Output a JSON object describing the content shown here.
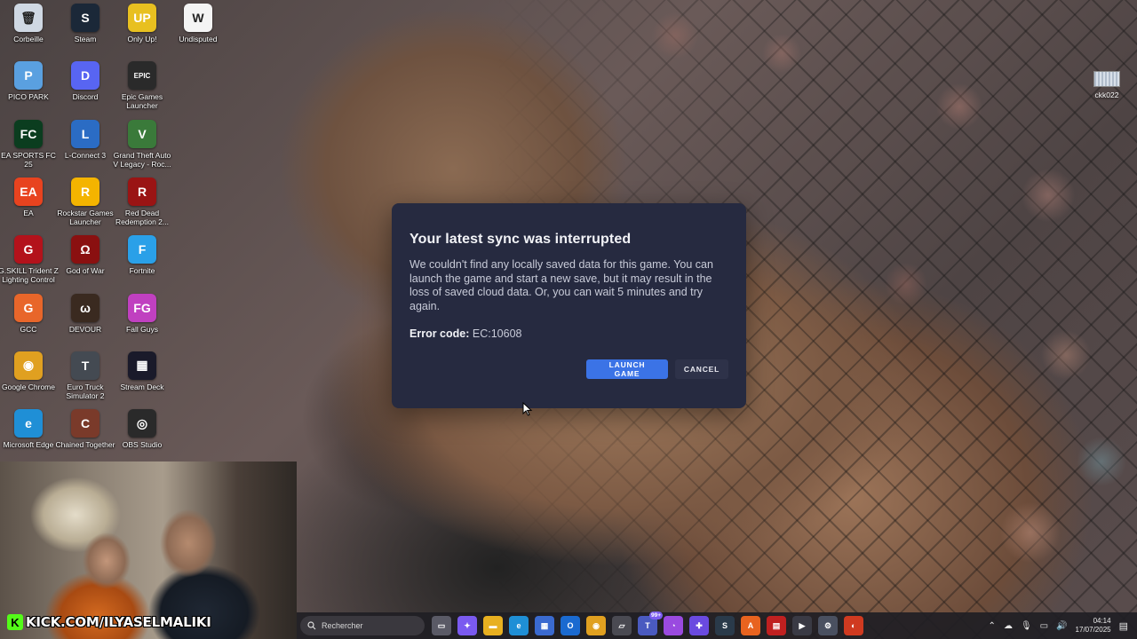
{
  "desktop": {
    "columns": [
      [
        {
          "label": "Corbeille",
          "icon": "recycle-bin-icon",
          "color": "#cfd8e3",
          "glyph": "🗑"
        },
        {
          "label": "PICO PARK",
          "icon": "pico-park-icon",
          "color": "#5aa0e0",
          "glyph": "P"
        },
        {
          "label": "EA SPORTS FC 25",
          "icon": "ea-fc-icon",
          "color": "#0b3d1f",
          "glyph": "FC"
        },
        {
          "label": "EA",
          "icon": "ea-icon",
          "color": "#e8431f",
          "glyph": "EA"
        },
        {
          "label": "G.SKILL Trident Z Lighting Control",
          "icon": "gskill-icon",
          "color": "#b3121b",
          "glyph": "G"
        },
        {
          "label": "GCC",
          "icon": "gcc-icon",
          "color": "#e8662a",
          "glyph": "G"
        },
        {
          "label": "Google Chrome",
          "icon": "chrome-icon",
          "color": "#e0a020",
          "glyph": "◉"
        },
        {
          "label": "Microsoft Edge",
          "icon": "edge-icon",
          "color": "#1f8fd6",
          "glyph": "e"
        }
      ],
      [
        {
          "label": "Steam",
          "icon": "steam-icon",
          "color": "#1b2838",
          "glyph": "S"
        },
        {
          "label": "Discord",
          "icon": "discord-icon",
          "color": "#5865f2",
          "glyph": "D"
        },
        {
          "label": "L-Connect 3",
          "icon": "l-connect-icon",
          "color": "#2b6cc4",
          "glyph": "L"
        },
        {
          "label": "Rockstar Games Launcher",
          "icon": "rockstar-icon",
          "color": "#f4b400",
          "glyph": "R"
        },
        {
          "label": "God of War",
          "icon": "god-of-war-icon",
          "color": "#8a1010",
          "glyph": "Ω"
        },
        {
          "label": "DEVOUR",
          "icon": "devour-icon",
          "color": "#3a2a20",
          "glyph": "ω"
        },
        {
          "label": "Euro Truck Simulator 2",
          "icon": "ets2-icon",
          "color": "#444a52",
          "glyph": "T"
        },
        {
          "label": "Chained Together",
          "icon": "chained-together-icon",
          "color": "#7a3a2a",
          "glyph": "C"
        }
      ],
      [
        {
          "label": "Only Up!",
          "icon": "only-up-icon",
          "color": "#e8c020",
          "glyph": "UP"
        },
        {
          "label": "Epic Games Launcher",
          "icon": "epic-games-icon",
          "color": "#2a2a2a",
          "glyph": "EPIC"
        },
        {
          "label": "Grand Theft Auto V Legacy - Roc...",
          "icon": "gta-v-icon",
          "color": "#3a7a3a",
          "glyph": "V"
        },
        {
          "label": "Red Dead Redemption 2...",
          "icon": "rdr2-icon",
          "color": "#9a1414",
          "glyph": "R"
        },
        {
          "label": "Fortnite",
          "icon": "fortnite-icon",
          "color": "#2aa0e8",
          "glyph": "F"
        },
        {
          "label": "Fall Guys",
          "icon": "fall-guys-icon",
          "color": "#c040c0",
          "glyph": "FG"
        },
        {
          "label": "Stream Deck",
          "icon": "stream-deck-icon",
          "color": "#1a1a2a",
          "glyph": "▦"
        },
        {
          "label": "OBS Studio",
          "icon": "obs-icon",
          "color": "#2a2a2a",
          "glyph": "◎"
        }
      ],
      [
        {
          "label": "Undisputed",
          "icon": "undisputed-icon",
          "color": "#f4f4f4",
          "glyph": "W"
        }
      ]
    ],
    "ckk": {
      "label": "ckk022",
      "icon": "image-file-icon"
    }
  },
  "dialog": {
    "title": "Your latest sync was interrupted",
    "body": "We couldn't find any locally saved data for this game. You can launch the game and start a new save, but it may result in the loss of saved cloud data. Or, you can wait 5 minutes and try again.",
    "error_label": "Error code:",
    "error_value": "EC:10608",
    "launch_label": "LAUNCH GAME",
    "cancel_label": "CANCEL"
  },
  "webcam": {
    "banner": "KICK.COM/ILYASELMALIKI"
  },
  "taskbar": {
    "search_placeholder": "Rechercher",
    "apps": [
      {
        "name": "task-view-icon",
        "color": "#5a5a66",
        "glyph": "▭"
      },
      {
        "name": "copilot-icon",
        "color": "#7a5af0",
        "glyph": "✦"
      },
      {
        "name": "file-explorer-icon",
        "color": "#e8b020",
        "glyph": "▬"
      },
      {
        "name": "edge-icon",
        "color": "#1f8fd6",
        "glyph": "e"
      },
      {
        "name": "ms-store-icon",
        "color": "#3a6ad0",
        "glyph": "▦"
      },
      {
        "name": "outlook-icon",
        "color": "#1a6ad0",
        "glyph": "O"
      },
      {
        "name": "chrome-icon",
        "color": "#e0a020",
        "glyph": "◉"
      },
      {
        "name": "gallery-icon",
        "color": "#4a4a52",
        "glyph": "▱"
      },
      {
        "name": "teams-icon",
        "color": "#4a5ac0",
        "glyph": "T",
        "badge": "99+"
      },
      {
        "name": "messenger-icon",
        "color": "#9a4ae0",
        "glyph": "◔"
      },
      {
        "name": "game-controller-icon",
        "color": "#6a4ae0",
        "glyph": "✚"
      },
      {
        "name": "steam-icon",
        "color": "#2a3a4a",
        "glyph": "S"
      },
      {
        "name": "ea-app-icon",
        "color": "#e8631f",
        "glyph": "A"
      },
      {
        "name": "vmware-icon",
        "color": "#c02020",
        "glyph": "▤"
      },
      {
        "name": "media-player-icon",
        "color": "#3a3a44",
        "glyph": "▶"
      },
      {
        "name": "settings-icon",
        "color": "#4a5060",
        "glyph": "⚙"
      },
      {
        "name": "game-launcher-icon",
        "color": "#d03a20",
        "glyph": "◐"
      }
    ],
    "time": "04:14",
    "date": "17/07/2025"
  }
}
